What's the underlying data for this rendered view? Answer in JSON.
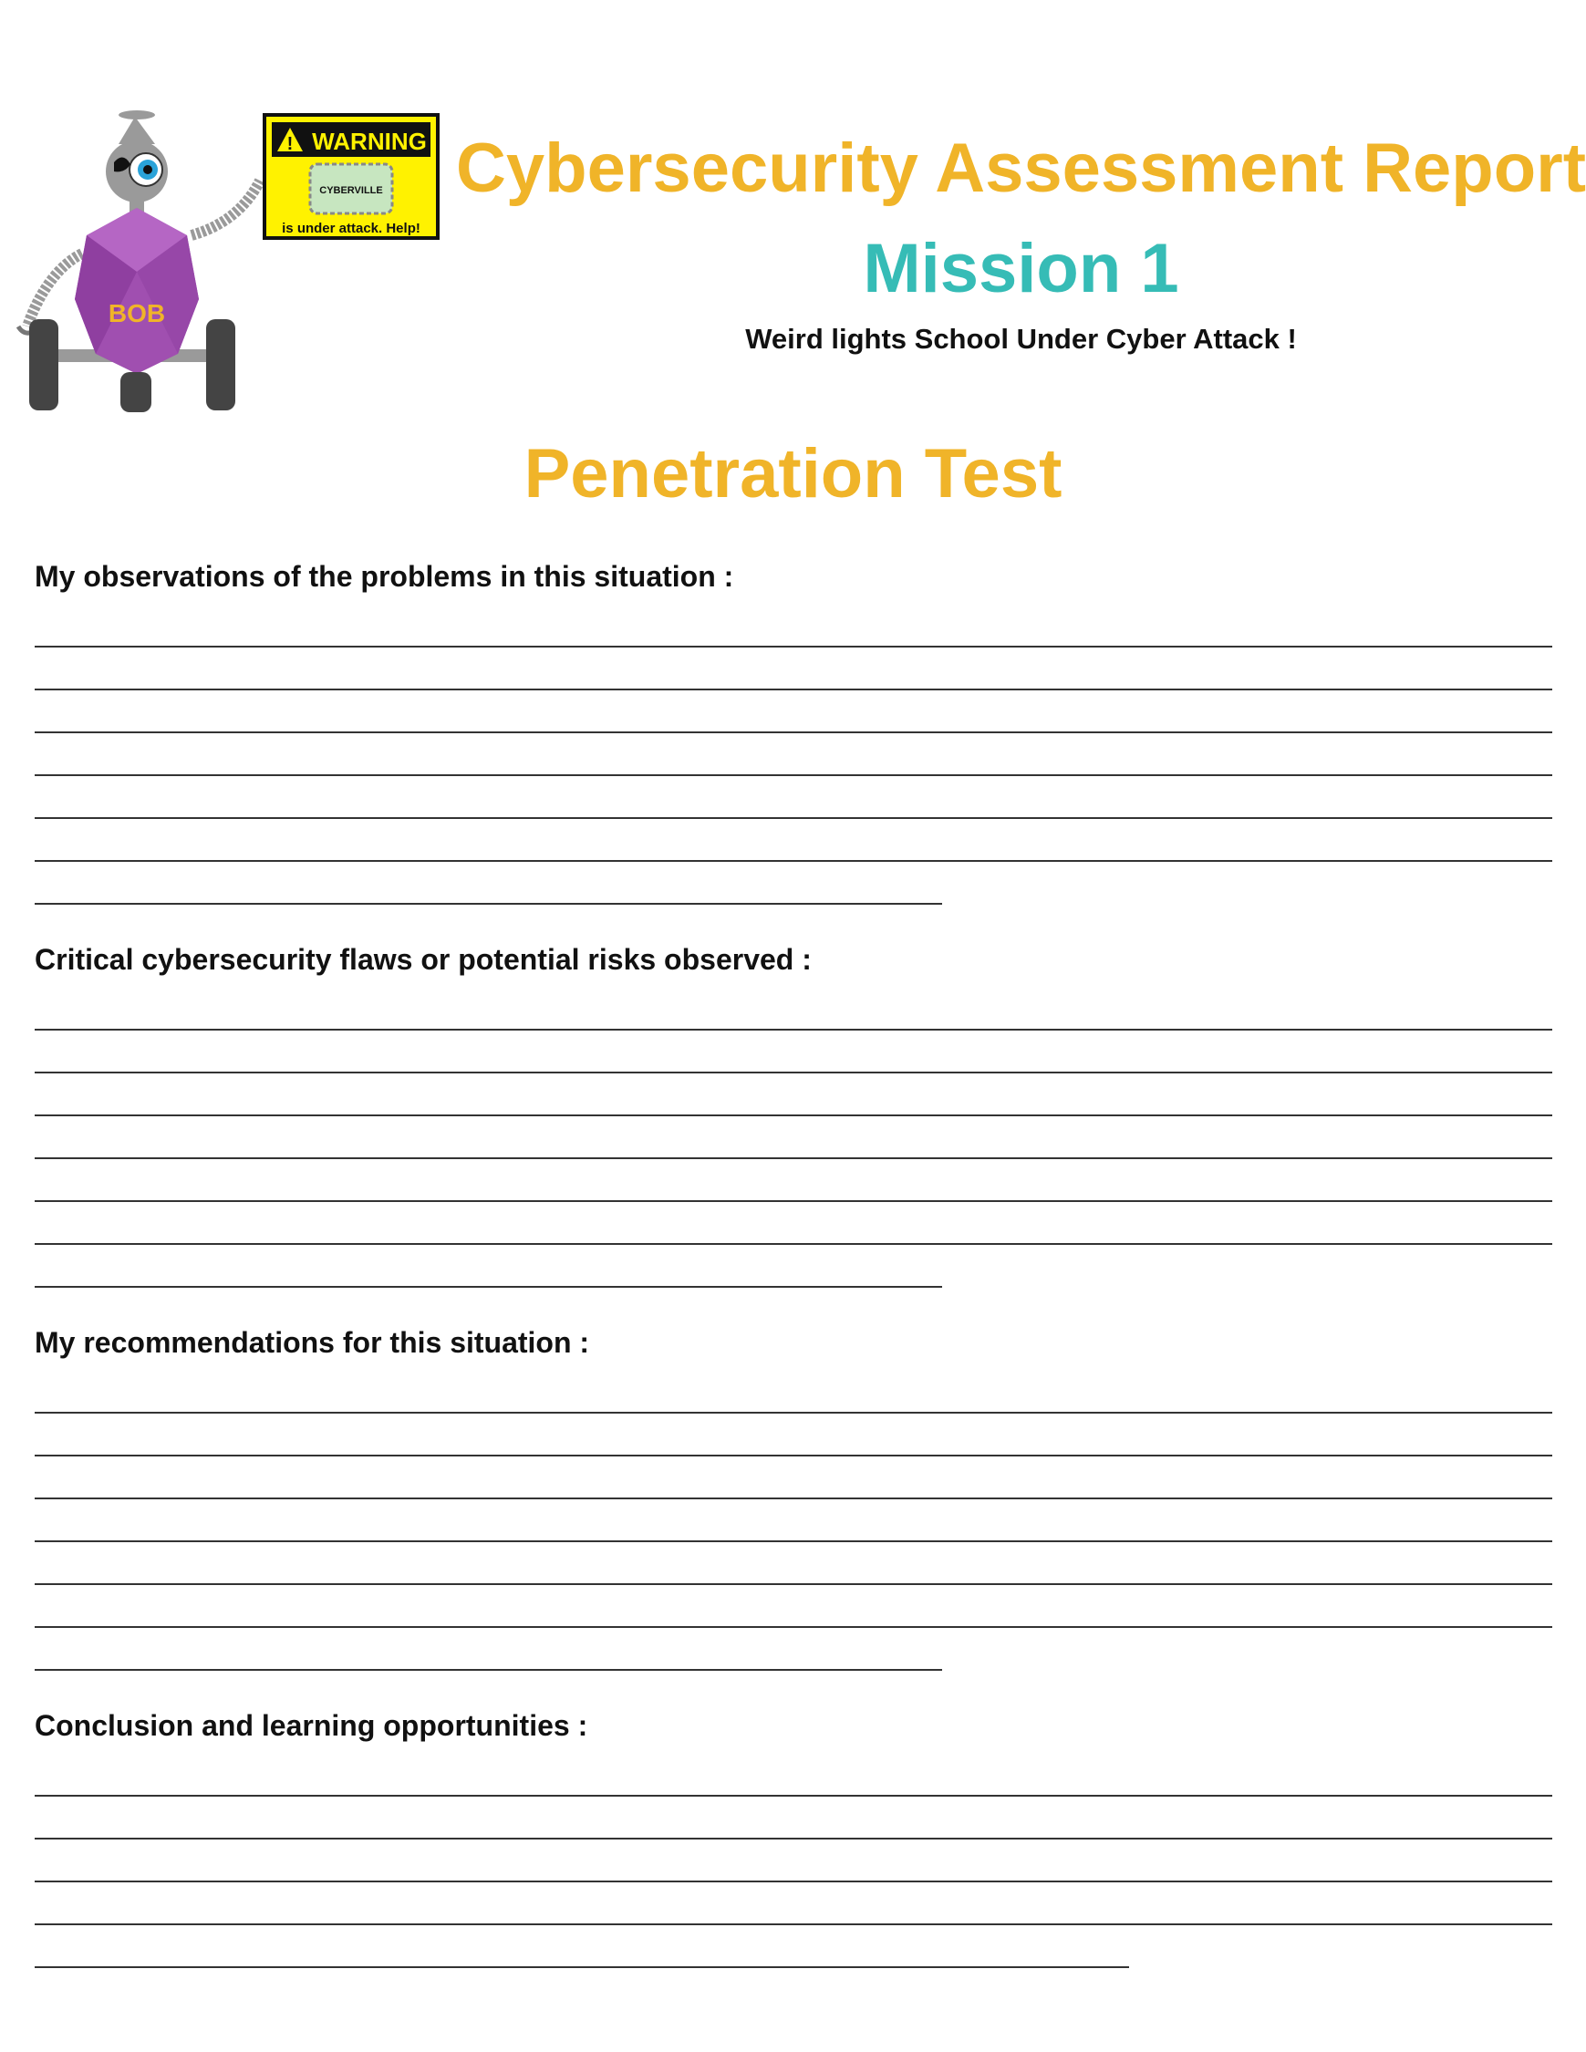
{
  "header": {
    "title": "Cybersecurity Assessment Report",
    "mission": "Mission 1",
    "subtitle": "Weird lights School Under Cyber Attack !"
  },
  "mascot": {
    "name_badge": "BOB",
    "sign_warning": "WARNING",
    "sign_screen": "CYBERVILLE",
    "sign_caption": "is under attack. Help!",
    "colors": {
      "body": "#a04fb0",
      "sign": "#fff200",
      "metal": "#9a9a9a",
      "eye": "#2aa3d9"
    }
  },
  "page_heading": "Penetration Test",
  "sections": [
    {
      "prompt": "My observations of the problems in this situation :"
    },
    {
      "prompt": "Critical cybersecurity flaws or potential risks observed :"
    },
    {
      "prompt": "My recommendations for this situation :"
    },
    {
      "prompt": "Conclusion and learning opportunities :"
    }
  ],
  "colors": {
    "accent_yellow": "#f0b429",
    "accent_teal": "#36bcb6",
    "text": "#111111"
  }
}
